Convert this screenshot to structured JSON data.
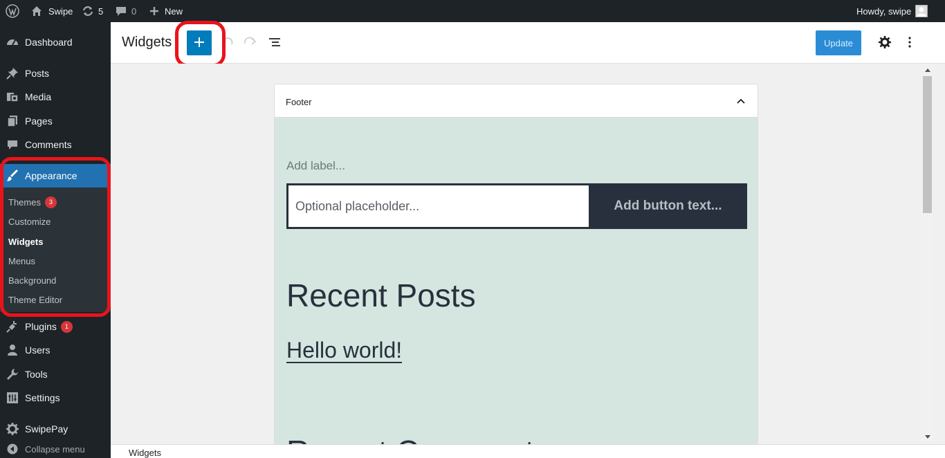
{
  "admin_bar": {
    "site_name": "Swipe",
    "updates_count": "5",
    "comments_count": "0",
    "new_label": "New",
    "greeting": "Howdy, swipe"
  },
  "sidebar": {
    "items": [
      {
        "label": "Dashboard",
        "icon": "dashboard-icon"
      },
      {
        "label": "Posts",
        "icon": "pin-icon"
      },
      {
        "label": "Media",
        "icon": "media-icon"
      },
      {
        "label": "Pages",
        "icon": "pages-icon"
      },
      {
        "label": "Comments",
        "icon": "comment-icon"
      },
      {
        "label": "Appearance",
        "icon": "paintbrush-icon"
      },
      {
        "label": "Plugins",
        "icon": "plugin-icon",
        "badge": "1"
      },
      {
        "label": "Users",
        "icon": "users-icon"
      },
      {
        "label": "Tools",
        "icon": "wrench-icon"
      },
      {
        "label": "Settings",
        "icon": "settings-icon"
      },
      {
        "label": "SwipePay",
        "icon": "gear-icon"
      },
      {
        "label": "Collapse menu",
        "icon": "collapse-icon"
      }
    ],
    "appearance_submenu": [
      {
        "label": "Themes",
        "badge": "3"
      },
      {
        "label": "Customize"
      },
      {
        "label": "Widgets",
        "current": true
      },
      {
        "label": "Menus"
      },
      {
        "label": "Background"
      },
      {
        "label": "Theme Editor"
      }
    ]
  },
  "header": {
    "title": "Widgets",
    "update_label": "Update"
  },
  "widget_area": {
    "title": "Footer",
    "search_label_placeholder": "Add label...",
    "search_input_placeholder": "Optional placeholder...",
    "search_button_placeholder": "Add button text...",
    "recent_posts_title": "Recent Posts",
    "recent_post_link": "Hello world!",
    "recent_comments_title": "Recent Comments"
  },
  "status": {
    "breadcrumb": "Widgets"
  },
  "colors": {
    "admin_bg": "#1d2327",
    "accent": "#2271b1",
    "inserter_blue": "#007cba",
    "highlight_ring": "#e8141c",
    "widget_bg": "#d4e6df",
    "badge_red": "#d63638"
  }
}
